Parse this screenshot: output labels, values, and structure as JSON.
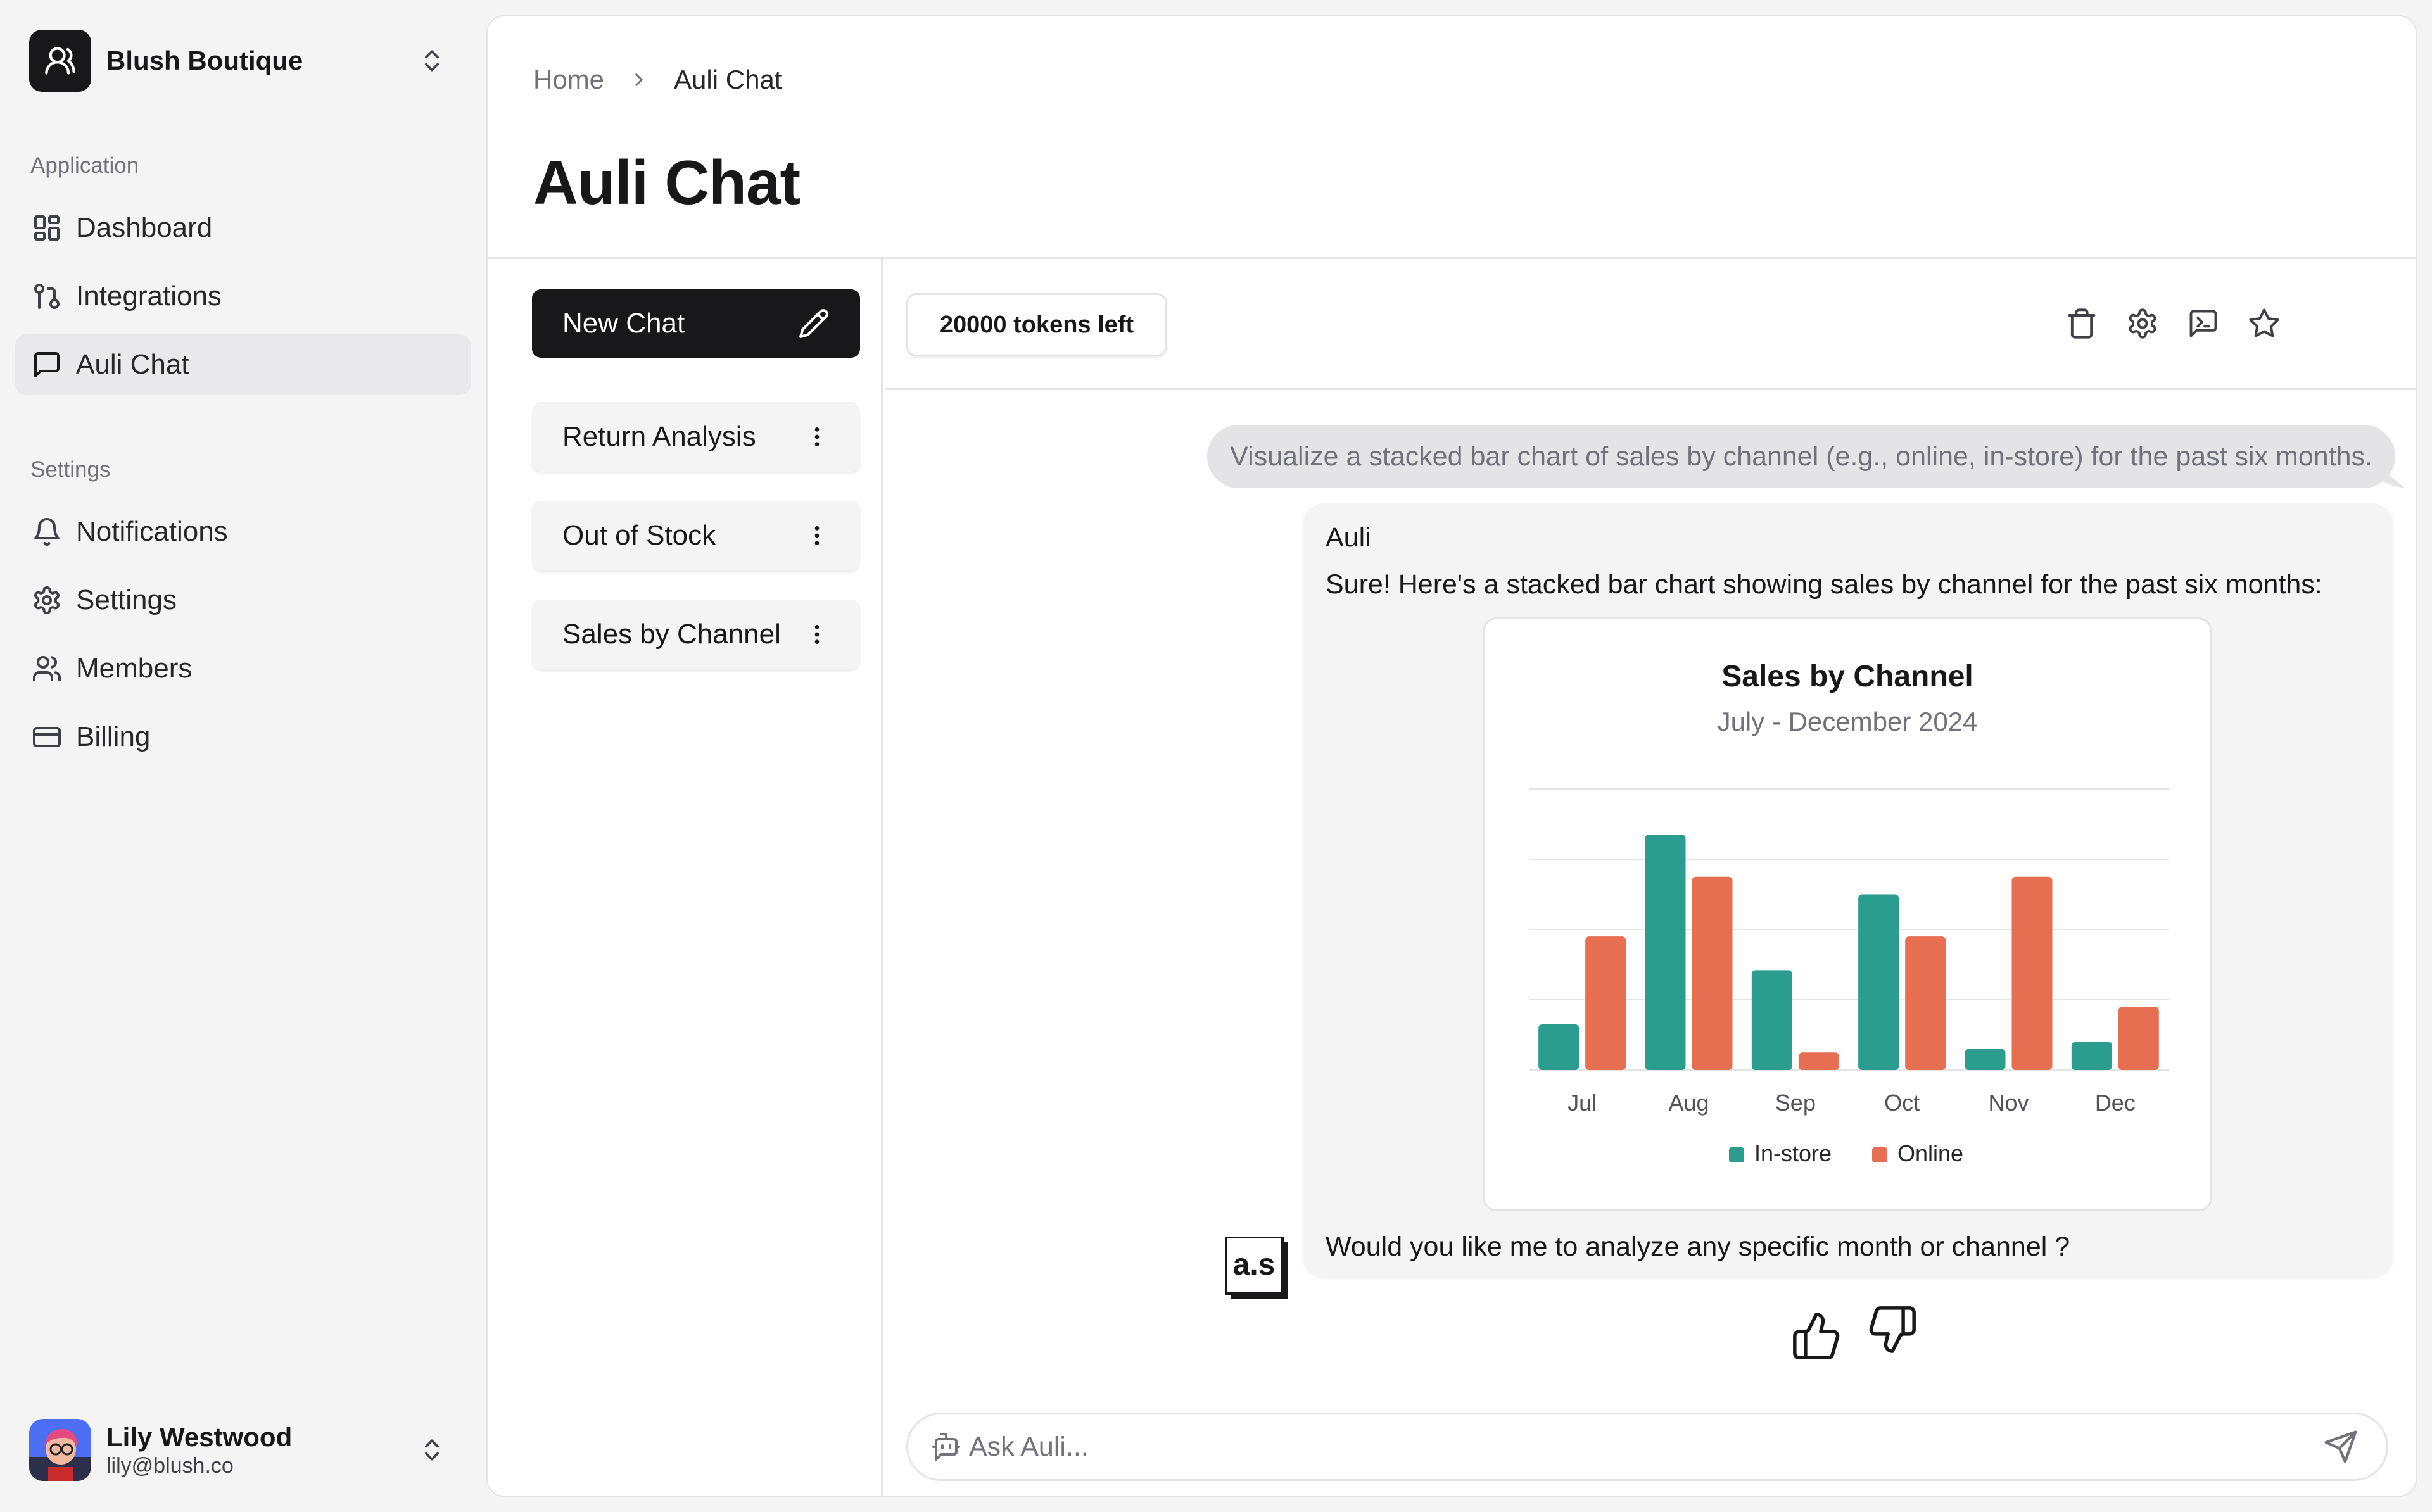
{
  "org": {
    "name": "Blush Boutique"
  },
  "sidebar": {
    "application_label": "Application",
    "application_items": [
      {
        "label": "Dashboard",
        "icon": "dashboard-icon"
      },
      {
        "label": "Integrations",
        "icon": "integrations-icon"
      },
      {
        "label": "Auli Chat",
        "icon": "chat-icon",
        "active": true
      }
    ],
    "settings_label": "Settings",
    "settings_items": [
      {
        "label": "Notifications",
        "icon": "bell-icon"
      },
      {
        "label": "Settings",
        "icon": "gear-icon"
      },
      {
        "label": "Members",
        "icon": "users-icon"
      },
      {
        "label": "Billing",
        "icon": "credit-card-icon"
      }
    ]
  },
  "user": {
    "name": "Lily Westwood",
    "email": "lily@blush.co"
  },
  "breadcrumb": {
    "home": "Home",
    "current": "Auli Chat"
  },
  "page": {
    "title": "Auli Chat"
  },
  "chats": {
    "new_chat_label": "New Chat",
    "items": [
      "Return Analysis",
      "Out of Stock",
      "Sales by Channel"
    ]
  },
  "toolbar": {
    "tokens": "20000 tokens left"
  },
  "conversation": {
    "user_message": "Visualize a stacked bar chart of sales by channel (e.g., online, in-store) for the past six months.",
    "bot_name": "Auli",
    "bot_intro": "Sure! Here's a stacked bar chart showing sales by channel for the past six months:",
    "bot_followup": "Would you like me to analyze any specific month or channel ?",
    "bot_avatar_text": "a.s"
  },
  "input": {
    "placeholder": "Ask Auli..."
  },
  "colors": {
    "in_store": "#2a9d8f",
    "online": "#e76f51",
    "accent": "#18181b"
  },
  "chart_data": {
    "type": "bar",
    "title": "Sales by Channel",
    "subtitle": "July - December 2024",
    "categories": [
      "Jul",
      "Aug",
      "Sep",
      "Oct",
      "Nov",
      "Dec"
    ],
    "series": [
      {
        "name": "In-store",
        "values": [
          65,
          335,
          142,
          250,
          30,
          40
        ]
      },
      {
        "name": "Online",
        "values": [
          190,
          275,
          25,
          190,
          275,
          90
        ]
      }
    ],
    "ylim": [
      0,
      400
    ],
    "grid": true,
    "y_tick_labels_visible": false,
    "legend": "bottom"
  }
}
